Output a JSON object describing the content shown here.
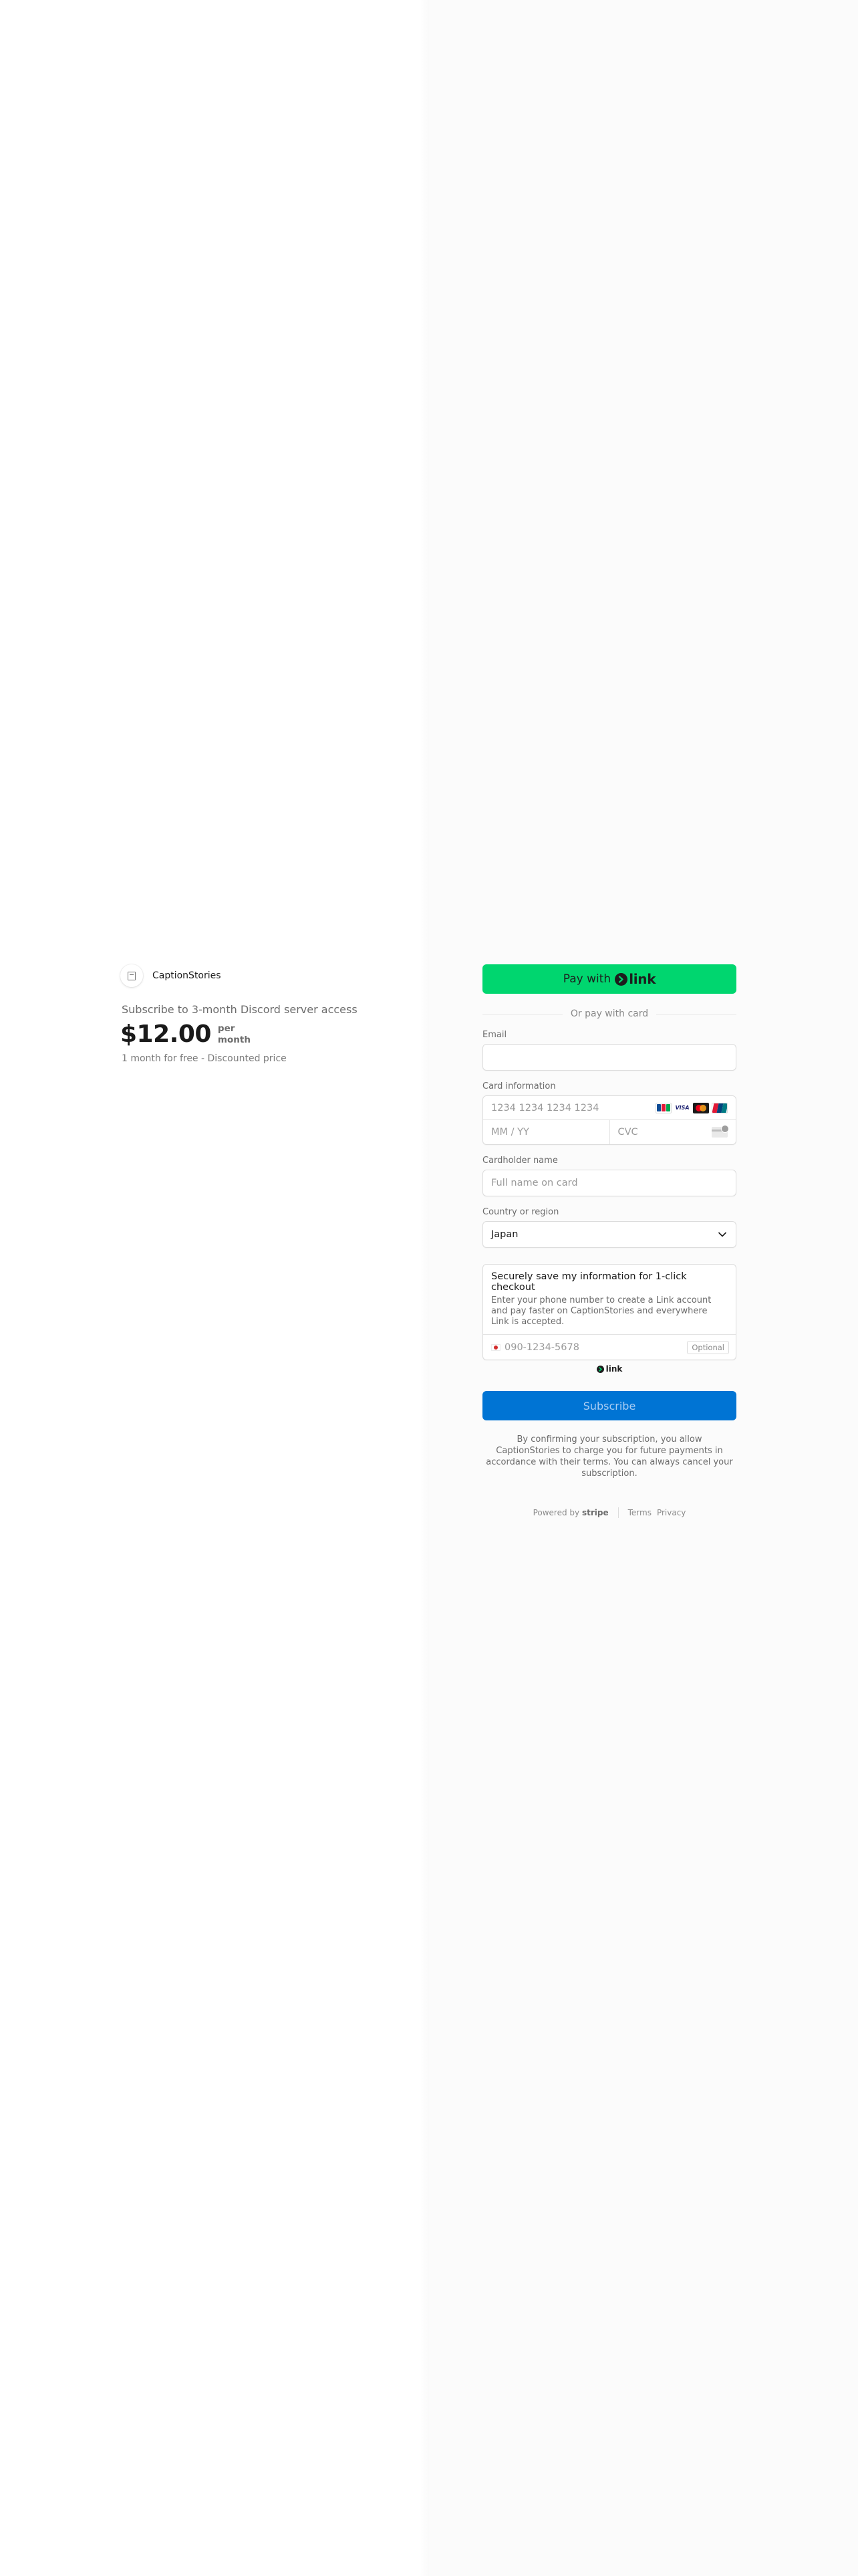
{
  "merchant": {
    "name": "CaptionStories"
  },
  "product": {
    "title": "Subscribe to 3-month Discord server access",
    "price": "$12.00",
    "price_unit_line1": "per",
    "price_unit_line2": "month",
    "subtitle": "1 month for free - Discounted price"
  },
  "checkout": {
    "link_button_prefix": "Pay with",
    "link_word": "link",
    "or_text": "Or pay with card",
    "email_label": "Email",
    "email_value": "",
    "card_label": "Card information",
    "card_number_placeholder": "1234 1234 1234 1234",
    "card_brands": [
      "jcb-icon",
      "visa-icon",
      "mastercard-icon",
      "unionpay-icon"
    ],
    "brand_visa_text": "VISA",
    "expiry_placeholder": "MM / YY",
    "cvc_placeholder": "CVC",
    "cardholder_label": "Cardholder name",
    "cardholder_placeholder": "Full name on card",
    "country_label": "Country or region",
    "country_value": "Japan",
    "save_title": "Securely save my information for 1-click checkout",
    "save_desc": "Enter your phone number to create a Link account and pay faster on CaptionStories and everywhere Link is accepted.",
    "phone_placeholder": "090-1234-5678",
    "optional_badge": "Optional",
    "link_mini_word": "link",
    "subscribe_label": "Subscribe",
    "terms_text": "By confirming your subscription, you allow CaptionStories to charge you for future payments in accordance with their terms. You can always cancel your subscription."
  },
  "footer": {
    "powered_prefix": "Powered by",
    "powered_brand": "stripe",
    "terms_link": "Terms",
    "privacy_link": "Privacy"
  },
  "colors": {
    "link_green": "#00d66f",
    "subscribe_blue": "#0074d4",
    "right_pane_bg": "#fbfbfb"
  }
}
